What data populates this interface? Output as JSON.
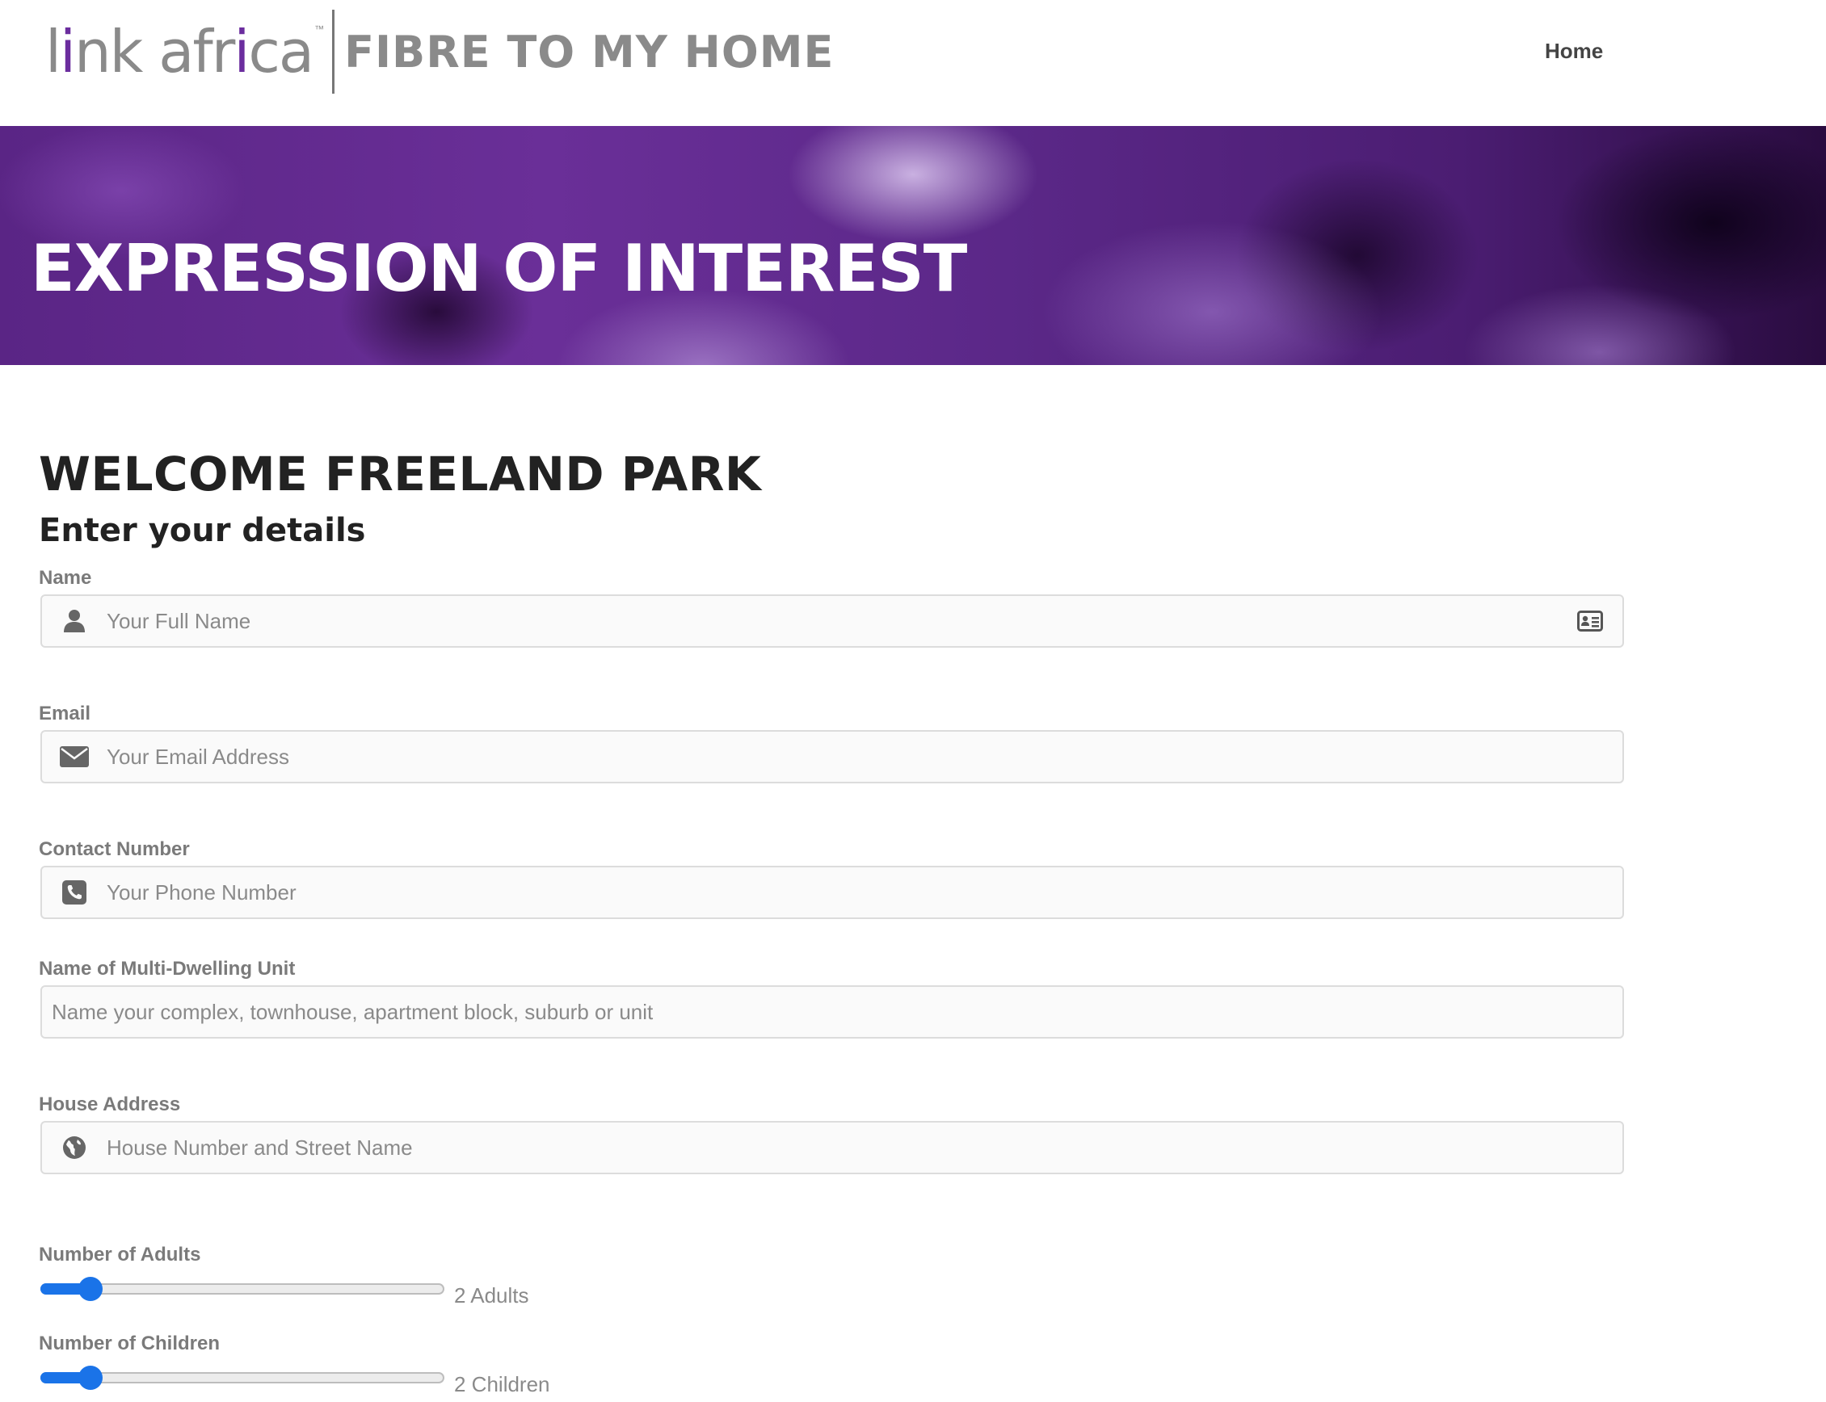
{
  "header": {
    "logo_brand_gray_1": "l",
    "logo_brand_purple_1": "i",
    "logo_brand_gray_2": "nk afr",
    "logo_brand_purple_2": "i",
    "logo_brand_gray_3": "ca",
    "logo_tm": "™",
    "logo_tagline": "FIBRE TO MY HOME",
    "nav_home": "Home"
  },
  "hero": {
    "title": "EXPRESSION OF INTEREST"
  },
  "main": {
    "welcome": "WELCOME FREELAND PARK",
    "subhead": "Enter your details"
  },
  "form": {
    "name": {
      "label": "Name",
      "placeholder": "Your Full Name",
      "icon": "user-icon",
      "trailing_icon": "contact-card-icon"
    },
    "email": {
      "label": "Email",
      "placeholder": "Your Email Address",
      "icon": "envelope-icon"
    },
    "phone": {
      "label": "Contact Number",
      "placeholder": "Your Phone Number",
      "icon": "phone-icon"
    },
    "mdu": {
      "label": "Name of Multi-Dwelling Unit",
      "placeholder": "Name your complex, townhouse, apartment block, suburb or unit"
    },
    "address": {
      "label": "House Address",
      "placeholder": "House Number and Street Name",
      "icon": "globe-icon"
    },
    "adults": {
      "label": "Number of Adults",
      "value_text": "2 Adults",
      "fraction": 0.12
    },
    "children": {
      "label": "Number of Children",
      "value_text": "2 Children",
      "fraction": 0.12
    }
  },
  "colors": {
    "accent": "#1a73e8",
    "brand_purple": "#6b2d9e",
    "label_gray": "#7a7a7a"
  }
}
